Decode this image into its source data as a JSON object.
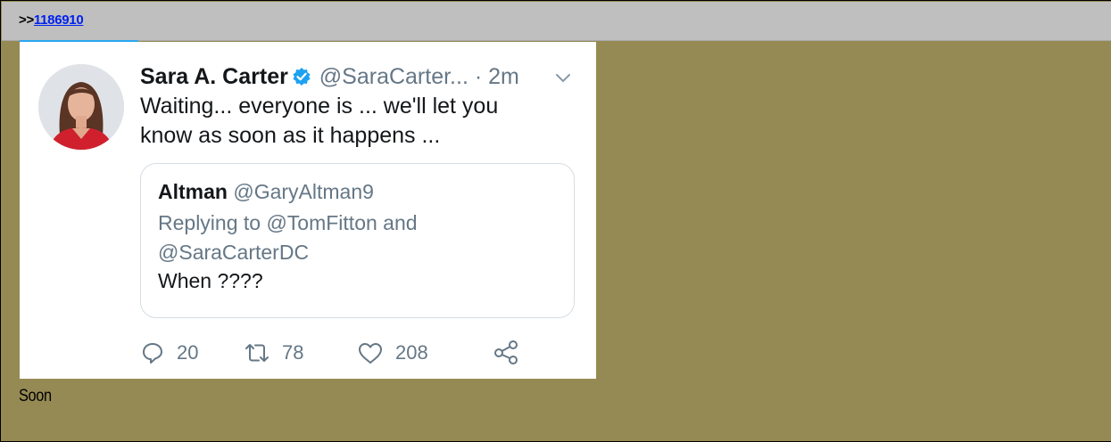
{
  "post": {
    "reply_prefix": ">>",
    "reply_ref": "1186910",
    "message": "Soon"
  },
  "tweet": {
    "author_name": "Sara A. Carter",
    "author_handle": "@SaraCarter...",
    "time": "· 2m",
    "text_line1": "Waiting... everyone is ... we'll let you",
    "text_line2": "know as soon as it happens ...",
    "quoted": {
      "name": "Altman",
      "handle": "@GaryAltman9",
      "reply_line1": "Replying to @TomFitton and",
      "reply_line2": "@SaraCarterDC",
      "body": "When ????"
    },
    "stats": {
      "replies": "20",
      "retweets": "78",
      "likes": "208"
    }
  },
  "icons": [
    "verified-badge-icon",
    "chevron-down-icon",
    "reply-icon",
    "retweet-icon",
    "like-icon",
    "share-icon"
  ],
  "colors": {
    "post_background": "#958a53",
    "header_background": "#bfbfbf",
    "link": "#0022ee",
    "twitter_blue": "#1da1f2",
    "muted_text": "#657786"
  }
}
